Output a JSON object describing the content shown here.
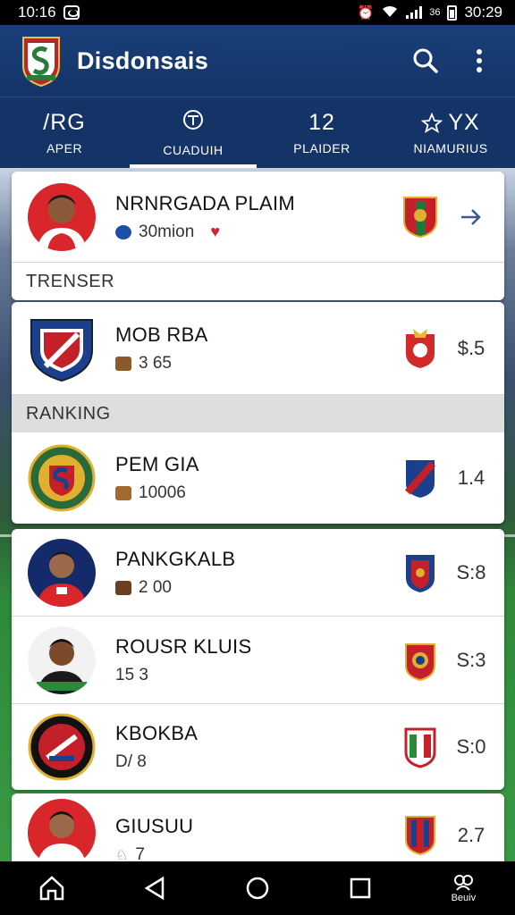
{
  "status_bar": {
    "time": "10:16",
    "clock_right": "30:29",
    "small_text": "36"
  },
  "app_bar": {
    "title": "Disdonsais",
    "search_icon": "search-icon",
    "more_icon": "more-vertical-icon"
  },
  "tabs": [
    {
      "top": "/RG",
      "label": "APER",
      "active": false
    },
    {
      "top": "",
      "label": "CUADUIH",
      "active": true
    },
    {
      "top": "12",
      "label": "PLAIDER",
      "active": false
    },
    {
      "top": "YX",
      "label": "NIAMURIUS",
      "active": false
    }
  ],
  "card1": {
    "player": {
      "name": "NRNRGADA PLAIM",
      "meta": "30mion"
    },
    "section_label": "TRENSER"
  },
  "card2": {
    "club": {
      "name": "MOB RBA",
      "meta": "3 65",
      "value": "$.5"
    },
    "section_label": "RANKING",
    "club2": {
      "name": "PEM GIA",
      "meta": "10006",
      "value": "1.4"
    }
  },
  "card3": {
    "rows": [
      {
        "name": "PANKGKALB",
        "meta": "2 00",
        "value": "S:8"
      },
      {
        "name": "ROUSR KLUIS",
        "meta": "15 3",
        "value": "S:3"
      },
      {
        "name": "KBOKBA",
        "meta": "D/ 8",
        "value": "S:0"
      }
    ]
  },
  "card4": {
    "name": "GIUSUU",
    "meta": "7",
    "value": "2.7"
  },
  "nav_bar": {
    "home_icon": "home-icon",
    "back_icon": "back-icon",
    "circle_icon": "home-circle-icon",
    "square_icon": "recents-icon",
    "extra_label": "Beuiv"
  },
  "colors": {
    "primary": "#143468",
    "accent": "#1a3f7a",
    "card": "#ffffff"
  }
}
